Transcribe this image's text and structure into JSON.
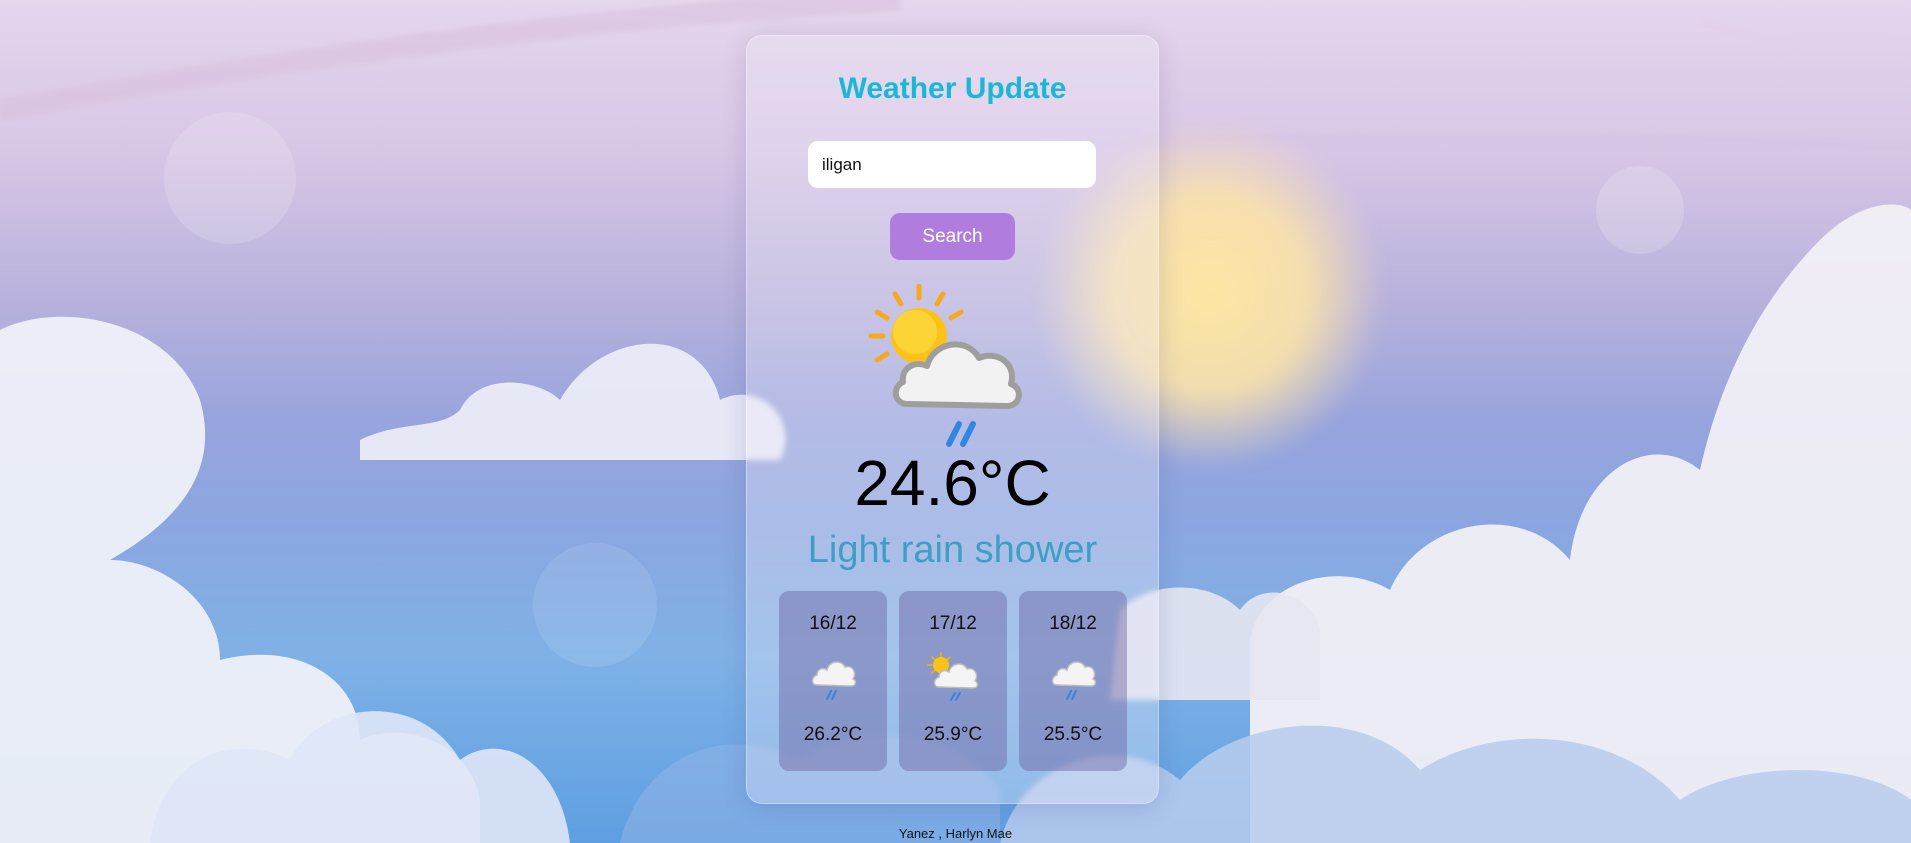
{
  "app": {
    "title": "Weather Update"
  },
  "search": {
    "value": "iligan",
    "button_label": "Search"
  },
  "current": {
    "icon": "sun-cloud-rain-icon",
    "temperature": "24.6°C",
    "condition": "Light rain shower"
  },
  "forecast": [
    {
      "date": "16/12",
      "icon": "cloud-rain-icon",
      "temperature": "26.2°C"
    },
    {
      "date": "17/12",
      "icon": "sun-cloud-rain-icon",
      "temperature": "25.9°C"
    },
    {
      "date": "18/12",
      "icon": "cloud-rain-icon",
      "temperature": "25.5°C"
    }
  ],
  "footer": {
    "credit": "Yanez , Harlyn Mae"
  },
  "colors": {
    "title": "#1bb8d6",
    "button": "#b07ddf",
    "condition": "#3f9ec4"
  }
}
